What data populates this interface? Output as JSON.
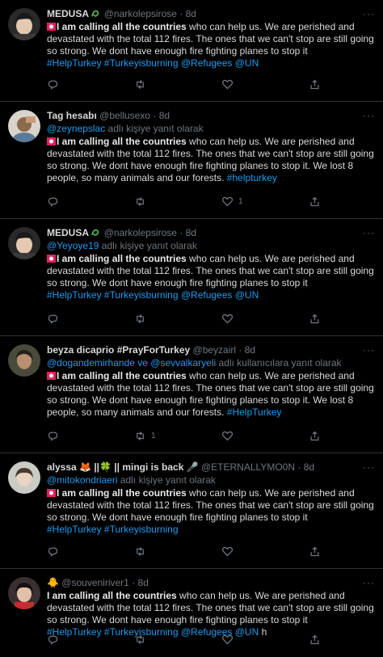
{
  "tweets": [
    {
      "name": "MEDUSA",
      "handle": "@narkolepsirose",
      "time": "8d",
      "replying_prefix": "",
      "replying_mention": "",
      "replying_suffix": "",
      "has_siren": true,
      "bold": "I am calling all the countries",
      "text": " who can help us. We are perished and devastated with the total 112 fires. The ones that we can't stop are still going so strong. We dont have enough fire fighting planes to stop it",
      "links": "#HelpTurkey #Turkeyisburning  @Refugees @UN",
      "trailing": "",
      "retweets": "",
      "likes": ""
    },
    {
      "name": "Tag hesabı",
      "handle": "@bellusexo",
      "time": "8d",
      "replying_prefix": "",
      "replying_mention": "@zeynepslac",
      "replying_suffix": " adlı kişiye yanıt olarak",
      "has_siren": true,
      "bold": "I am calling all the countries",
      "text": " who can help us. We are perished and devastated with the total 112 fires. The ones that we can't stop are still going so strong. We dont have enough fire fighting planes to stop it. We lost 8 people, so many animals and our forests. ",
      "links": "#helpturkey",
      "trailing": "",
      "retweets": "",
      "likes": "1"
    },
    {
      "name": "MEDUSA",
      "handle": "@narkolepsirose",
      "time": "8d",
      "replying_prefix": "",
      "replying_mention": "@Yeyoye19",
      "replying_suffix": " adlı kişiye yanıt olarak",
      "has_siren": true,
      "bold": "I am calling all the countries",
      "text": " who can help us. We are perished and devastated with the total 112 fires. The ones that we can't stop are still going so strong. We dont have enough fire fighting planes to stop it",
      "links": "#HelpTurkey #Turkeyisburning  @Refugees @UN",
      "trailing": "",
      "retweets": "",
      "likes": ""
    },
    {
      "name": "beyza dicaprio #PrayForTurkey",
      "handle": "@beyzairl",
      "time": "8d",
      "replying_prefix": "",
      "replying_mention": "@dogandemirhande ve @sevvalkaryeli",
      "replying_suffix": " adlı kullanıcılara yanıt olarak",
      "has_siren": true,
      "bold": "I am calling all the countries",
      "text": " who can help us. We are perished and devastated with the total 112 fires. The ones that we can't stop are still going so strong. We dont have enough fire fighting planes to stop it. We lost 8 people, so many animals and our forests. ",
      "links": "#HelpTurkey",
      "trailing": "",
      "retweets": "1",
      "likes": ""
    },
    {
      "name": "alyssa 🦊 ||🍀 || mingi is back 🎤",
      "handle": "@ETERNALLYMO0N",
      "time": "8d",
      "replying_prefix": "",
      "replying_mention": "@mitokondriaeri",
      "replying_suffix": " adlı kişiye yanıt olarak",
      "has_siren": true,
      "bold": "I am calling all the countries",
      "text": " who can help us. We are perished and devastated with the total 112 fires. The ones that we can't stop are still going so strong. We dont have enough fire fighting planes to stop it",
      "links": "#HelpTurkey #Turkeyisburning",
      "trailing": "",
      "retweets": "",
      "likes": ""
    },
    {
      "name": "🐥",
      "handle": "@souveniriver1",
      "time": "8d",
      "replying_prefix": "",
      "replying_mention": "",
      "replying_suffix": "",
      "has_siren": false,
      "bold": "I am calling all the countries",
      "text": " who can help us. We are perished and devastated with the total 112 fires. The ones that we can't stop are still going so strong. We dont have enough fire fighting planes to stop it",
      "links": "#HelpTurkey #Turkeyisburning  @Refugees @UN",
      "trailing": " h",
      "retweets": "",
      "likes": ""
    }
  ],
  "separator_dot": "·",
  "colors": {
    "link": "#1d9bf0",
    "muted": "#6e767d",
    "siren": "#e0245e",
    "medusa_logo": "#4caf50"
  }
}
